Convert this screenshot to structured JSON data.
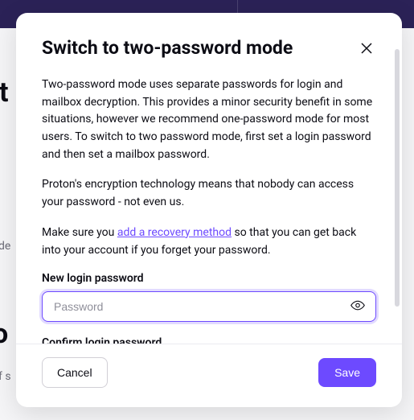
{
  "modal": {
    "title": "Switch to two-password mode",
    "paragraph1": "Two-password mode uses separate passwords for login and mailbox decryption. This provides a minor security benefit in some situations, however we recommend one-password mode for most users. To switch to two password mode, first set a login password and then set a mailbox password.",
    "paragraph2": "Proton's encryption technology means that nobody can access your password - not even us.",
    "paragraph3_prefix": "Make sure you ",
    "paragraph3_link": "add a recovery method",
    "paragraph3_suffix": " so that you can get back into your account if you forget your password.",
    "field1_label": "New login password",
    "field1_placeholder": "Password",
    "field1_value": "",
    "field2_label": "Confirm login password",
    "cancel_label": "Cancel",
    "save_label": "Save"
  },
  "background": {
    "heading_fragment1": "nt",
    "text_fragment1": "ode",
    "heading_fragment2": "to",
    "text_fragment2": "of s"
  },
  "colors": {
    "accent": "#6d4aff",
    "topbar": "#2b2257"
  }
}
